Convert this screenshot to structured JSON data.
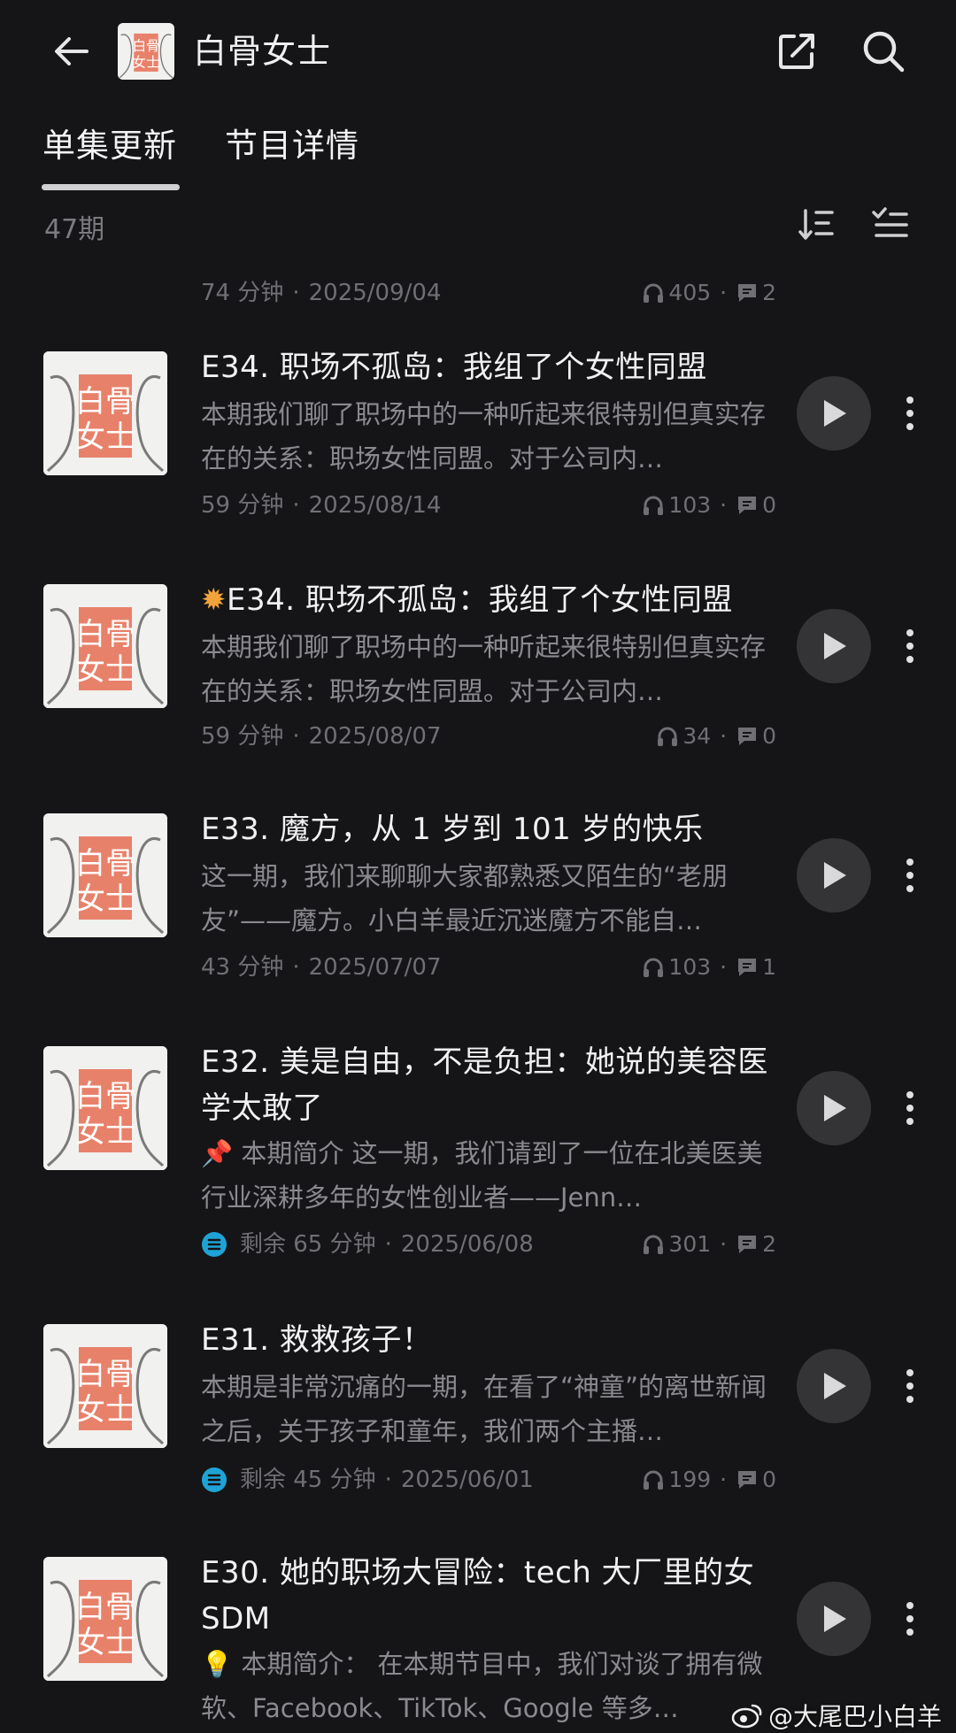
{
  "header": {
    "title": "白骨女士",
    "cover_text_top": "白骨",
    "cover_text_bottom": "女士"
  },
  "tabs": [
    {
      "label": "单集更新",
      "active": true
    },
    {
      "label": "节目详情",
      "active": false
    }
  ],
  "episode_count": "47期",
  "top_partial": {
    "duration": "74 分钟",
    "date": "2025/09/04",
    "plays": "405",
    "comments": "2"
  },
  "episodes": [
    {
      "title": "E34. 职场不孤岛：我组了个女性同盟",
      "desc": "本期我们聊了职场中的一种听起来很特别但真实存在的关系：职场女性同盟。对于公司内…",
      "duration": "59 分钟",
      "date": "2025/08/14",
      "plays": "103",
      "comments": "0"
    },
    {
      "title_icon": "✹",
      "title": "E34. 职场不孤岛：我组了个女性同盟",
      "desc": "本期我们聊了职场中的一种听起来很特别但真实存在的关系：职场女性同盟。对于公司内…",
      "duration": "59 分钟",
      "date": "2025/08/07",
      "plays": "34",
      "comments": "0"
    },
    {
      "title": "E33. 魔方，从 1 岁到 101 岁的快乐",
      "desc": "这一期，我们来聊聊大家都熟悉又陌生的“老朋友”——魔方。小白羊最近沉迷魔方不能自…",
      "duration": "43 分钟",
      "date": "2025/07/07",
      "plays": "103",
      "comments": "1"
    },
    {
      "title": "E32. 美是自由，不是负担：她说的美容医学太敢了",
      "desc": "📌 本期简介 这一期，我们请到了一位在北美医美行业深耕多年的女性创业者——Jenn…",
      "duration": "剩余 65 分钟",
      "date": "2025/06/08",
      "plays": "301",
      "comments": "2"
    },
    {
      "title": "E31. 救救孩子！",
      "desc": "本期是非常沉痛的一期，在看了“神童”的离世新闻之后，关于孩子和童年，我们两个主播…",
      "duration": "剩余 45 分钟",
      "date": "2025/06/01",
      "plays": "199",
      "comments": "0"
    },
    {
      "title": "E30. 她的职场大冒险：tech 大厂里的女 SDM",
      "desc": "💡 本期简介： 在本期节目中，我们对谈了拥有微软、Facebook、TikTok、Google 等多…"
    }
  ],
  "watermark": "@大尾巴小白羊",
  "colors": {
    "background": "#151517",
    "accent_cover": "#e8816a",
    "remaining_icon": "#1fa3d6"
  }
}
